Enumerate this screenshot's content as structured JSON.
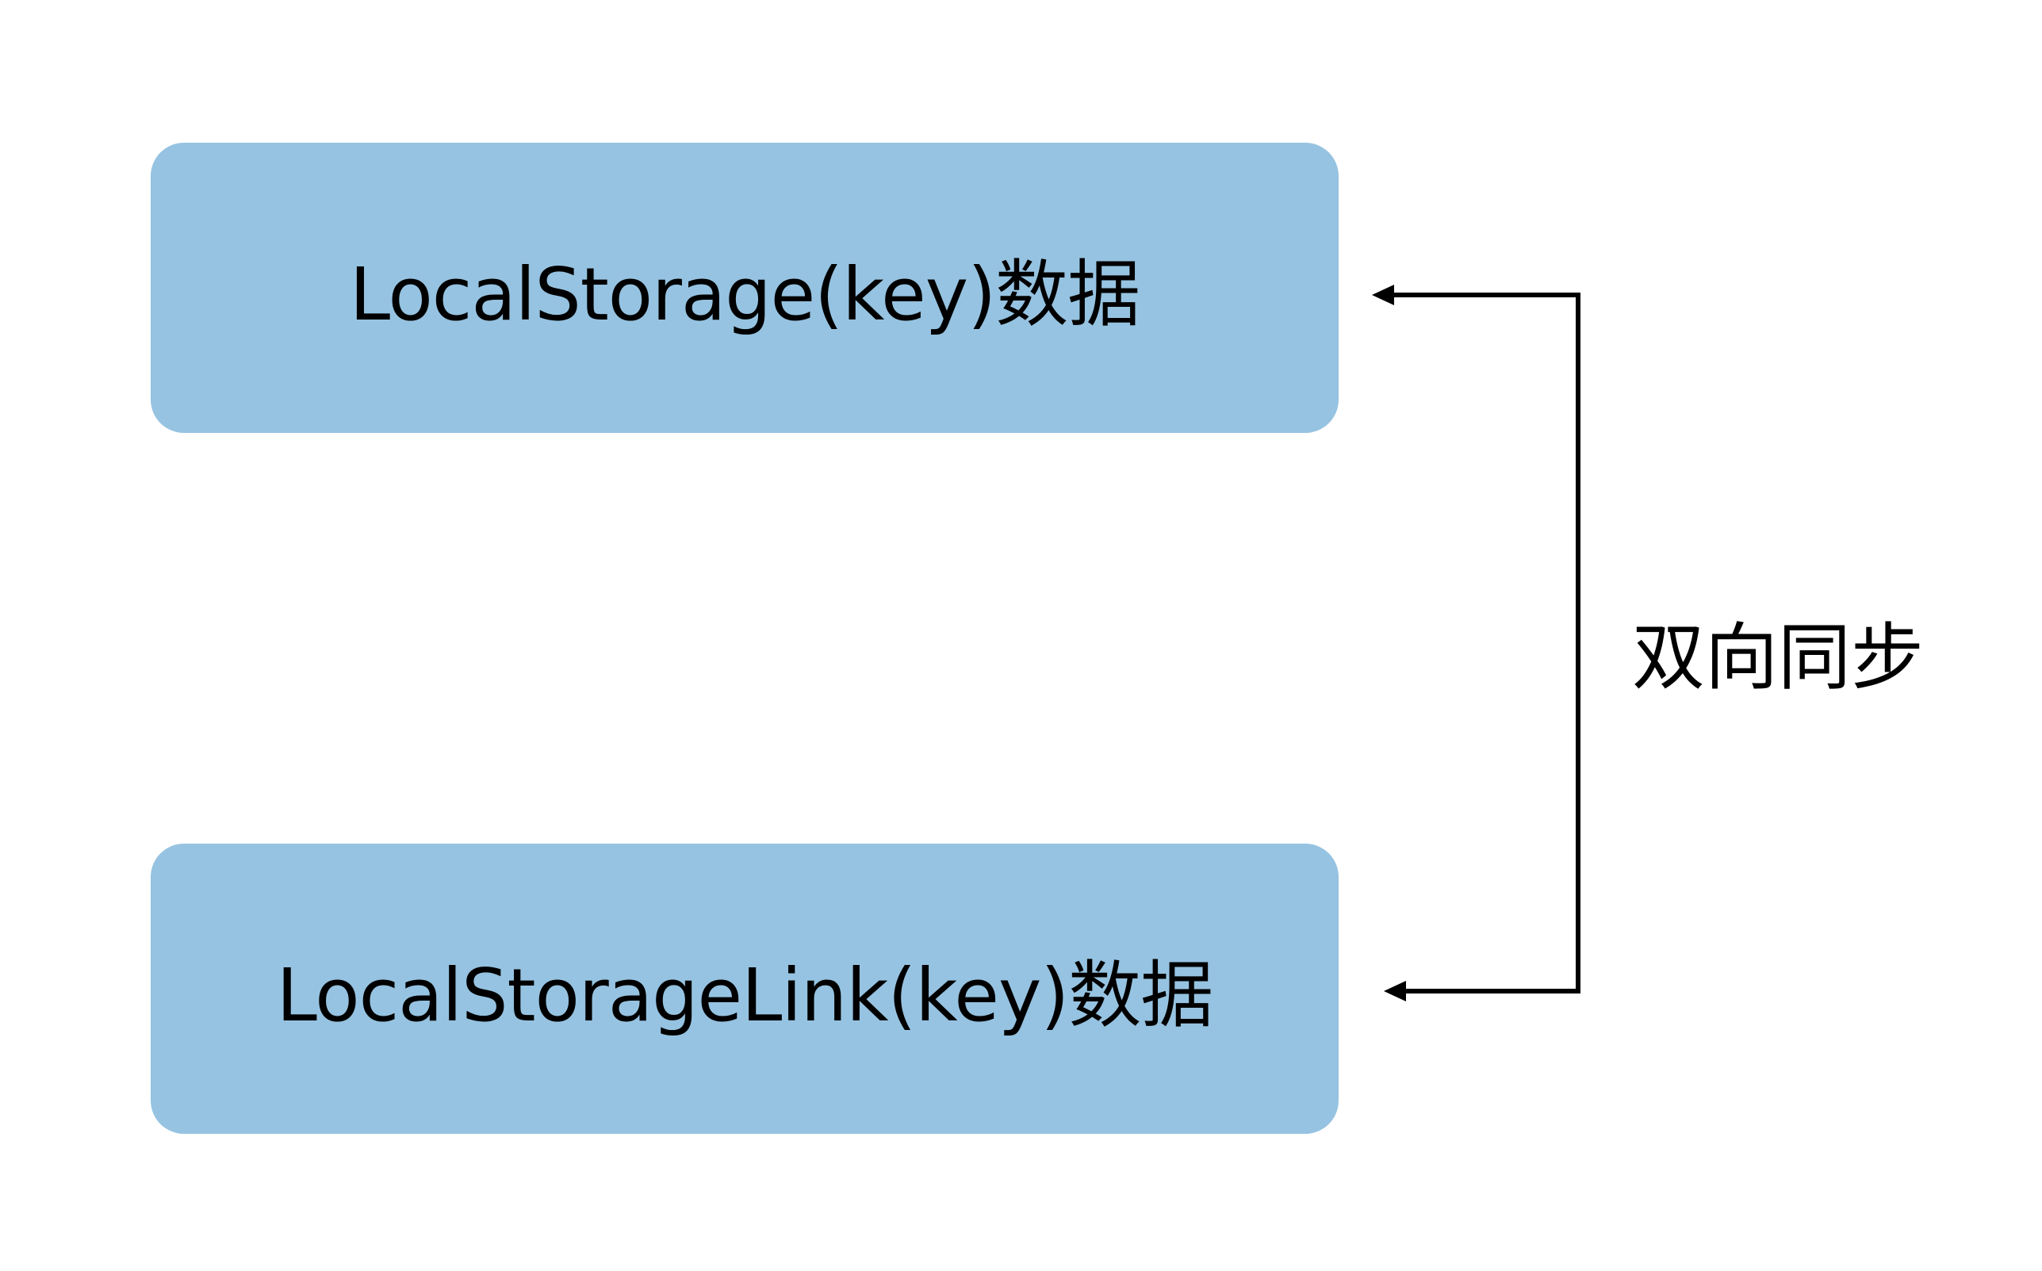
{
  "diagram": {
    "top_node": {
      "label": "LocalStorage(key)数据"
    },
    "bottom_node": {
      "label": "LocalStorageLink(key)数据"
    },
    "connector": {
      "label": "双向同步",
      "relation": "bidirectional-sync"
    },
    "colors": {
      "node_fill": "#96c3e1",
      "line": "#000000",
      "background": "#ffffff"
    }
  }
}
